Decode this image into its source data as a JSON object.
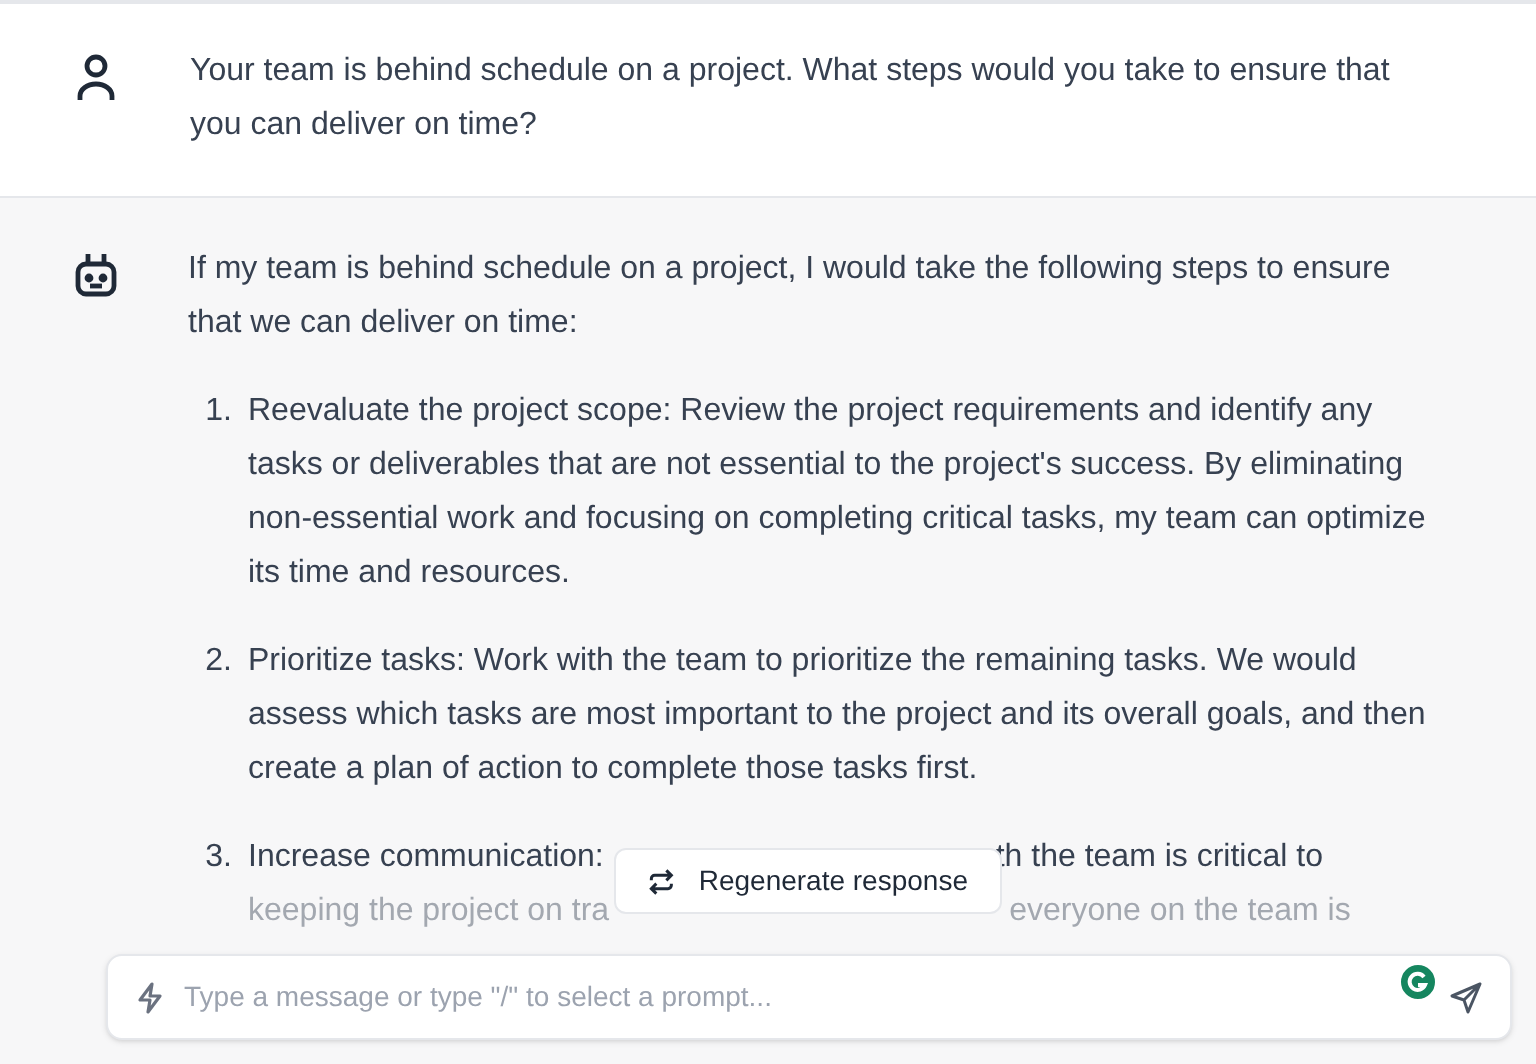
{
  "user_message": {
    "text": "Your team is behind schedule on a project. What steps would you take to ensure that you can deliver on time?"
  },
  "bot_message": {
    "intro": "If my team is behind schedule on a project, I would take the following steps to ensure that we can deliver on time:",
    "items": [
      {
        "number": "1.",
        "text": "Reevaluate the project scope: Review the project requirements and identify any tasks or deliverables that are not essential to the project's success. By eliminating non-essential work and focusing on completing critical tasks, my team can optimize its time and resources."
      },
      {
        "number": "2.",
        "text": "Prioritize tasks: Work with the team to prioritize the remaining tasks. We would assess which tasks are most important to the project and its overall goals, and then create a plan of action to complete those tasks first."
      }
    ],
    "partial_item": {
      "number": "3.",
      "text_start": "Increase communication:",
      "text_end": "th the team is critical to",
      "line_2_start": "keeping the project on tra",
      "line_2_end": "everyone on the team is"
    }
  },
  "regenerate_button": {
    "label": "Regenerate response"
  },
  "composer": {
    "placeholder": "Type a message or type \"/\" to select a prompt..."
  }
}
